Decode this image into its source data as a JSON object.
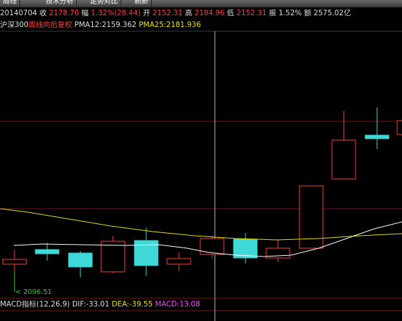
{
  "toolbar": {
    "items": [
      "周线",
      "技术分析",
      "走势对比",
      "刷新"
    ]
  },
  "quote": {
    "date": "20140704",
    "close_label": "收",
    "close": "2178.70",
    "change_label": "幅",
    "change": "1.32%(28.44)",
    "open_label": "开",
    "open": "2152.31",
    "high_label": "高",
    "high": "2184.96",
    "low_label": "低",
    "low": "2152.31",
    "amp_label": "振",
    "amp": "1.52%",
    "amount_label": "额",
    "amount": "2575.02亿"
  },
  "indicator": {
    "index_name": "沪深300",
    "adjust_mode": "周线向后复权",
    "pma12": "PMA12:2159.362",
    "pma25": "PMA25:2181.936"
  },
  "chart": {
    "low_marker": "2096.51"
  },
  "macd": {
    "name": "MACD指标(12,26,9)",
    "dif": "DIF:-33.01",
    "dea": "DEA:-39.55",
    "macd": "MACD:13.08"
  },
  "colors": {
    "up": "#ff3b3b",
    "down": "#3ed8d8",
    "pma12": "#ffffff",
    "pma25": "#e8e000",
    "grid": "#8b1a1a"
  }
}
